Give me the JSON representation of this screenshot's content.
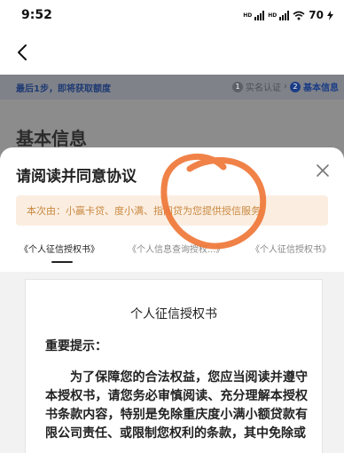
{
  "status_bar": {
    "time": "9:52",
    "signal_label_1": "HD",
    "signal_label_2": "HD",
    "battery": "70"
  },
  "nav": {
    "back_icon": "chevron-left-icon"
  },
  "background_page": {
    "step_hint": "最后1步，即将获取额度",
    "steps": [
      {
        "number": "1",
        "label": "实名认证",
        "active": false
      },
      {
        "number": "2",
        "label": "基本信息",
        "active": true
      }
    ],
    "step_separator": "›",
    "title": "基本信息"
  },
  "sheet": {
    "title": "请阅读并同意协议",
    "close_icon": "close-icon",
    "notice": "本次由：小赢卡贷、度小满、指间贷为您提供授信服务",
    "tabs": [
      {
        "label": "《个人征信授权书》",
        "selected": true
      },
      {
        "label": "《个人信息查询授权...》",
        "selected": false
      },
      {
        "label": "《个人征信授权书》",
        "selected": false
      }
    ],
    "document": {
      "title": "个人征信授权书",
      "subtitle": "重要提示：",
      "body": "为了保障您的合法权益，您应当阅读并遵守本授权书，请您务必审慎阅读、充分理解本授权书条款内容，特别是免除重庆度小满小额贷款有限公司责任、或限制您权利的条款，其中免除或"
    }
  },
  "colors": {
    "dim_overlay": "#8c8c8c",
    "notice_bg": "#fbeee1",
    "notice_text": "#c98840",
    "step_active": "#1b3d86",
    "annotation_circle": "#ee7434"
  }
}
